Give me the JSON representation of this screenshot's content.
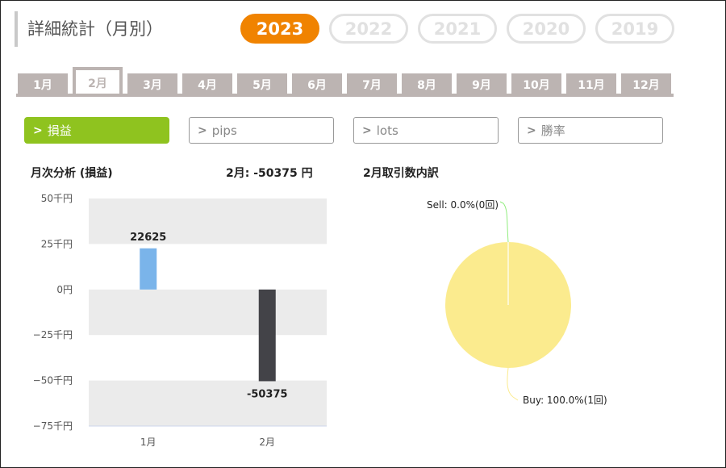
{
  "page_title": "詳細統計（月別）",
  "years": [
    {
      "label": "2023",
      "active": true
    },
    {
      "label": "2022",
      "active": false
    },
    {
      "label": "2021",
      "active": false
    },
    {
      "label": "2020",
      "active": false
    },
    {
      "label": "2019",
      "active": false
    }
  ],
  "months": [
    {
      "label": "1月",
      "active": false
    },
    {
      "label": "2月",
      "active": true
    },
    {
      "label": "3月",
      "active": false
    },
    {
      "label": "4月",
      "active": false
    },
    {
      "label": "5月",
      "active": false
    },
    {
      "label": "6月",
      "active": false
    },
    {
      "label": "7月",
      "active": false
    },
    {
      "label": "8月",
      "active": false
    },
    {
      "label": "9月",
      "active": false
    },
    {
      "label": "10月",
      "active": false
    },
    {
      "label": "11月",
      "active": false
    },
    {
      "label": "12月",
      "active": false
    }
  ],
  "metrics": [
    {
      "label": "損益",
      "active": true
    },
    {
      "label": "pips",
      "active": false
    },
    {
      "label": "lots",
      "active": false
    },
    {
      "label": "勝率",
      "active": false
    }
  ],
  "colors": {
    "accent_orange": "#f08300",
    "accent_green": "#8fc31f",
    "tab_gray": "#bcb4b2",
    "bar_positive": "#7ab4ea",
    "bar_negative": "#434348",
    "pie_buy": "#fbeb8e",
    "pie_sell": "#90ed7d"
  },
  "icons": {
    "metric_chevron": "chevron-right-icon"
  },
  "chart_data": [
    {
      "type": "bar",
      "title": "月次分析 (損益)",
      "summary": "2月:  -50375 円",
      "categories": [
        "1月",
        "2月"
      ],
      "values": [
        22625,
        -50375
      ],
      "data_labels": [
        "22625",
        "-50375"
      ],
      "ylim": [
        -75000,
        50000
      ],
      "yticks": [
        50000,
        25000,
        0,
        -25000,
        -50000,
        -75000
      ],
      "ytick_labels": [
        "50千円",
        "25千円",
        "0円",
        "−25千円",
        "−50千円",
        "−75千円"
      ],
      "alternating_bands": true,
      "legend": "none"
    },
    {
      "type": "pie",
      "title": "2月取引数内訳",
      "slices": [
        {
          "label": "Sell: 0.0%(0回)",
          "name": "Sell",
          "value": 0,
          "count": 0
        },
        {
          "label": "Buy: 100.0%(1回)",
          "name": "Buy",
          "value": 100,
          "count": 1
        }
      ]
    }
  ]
}
